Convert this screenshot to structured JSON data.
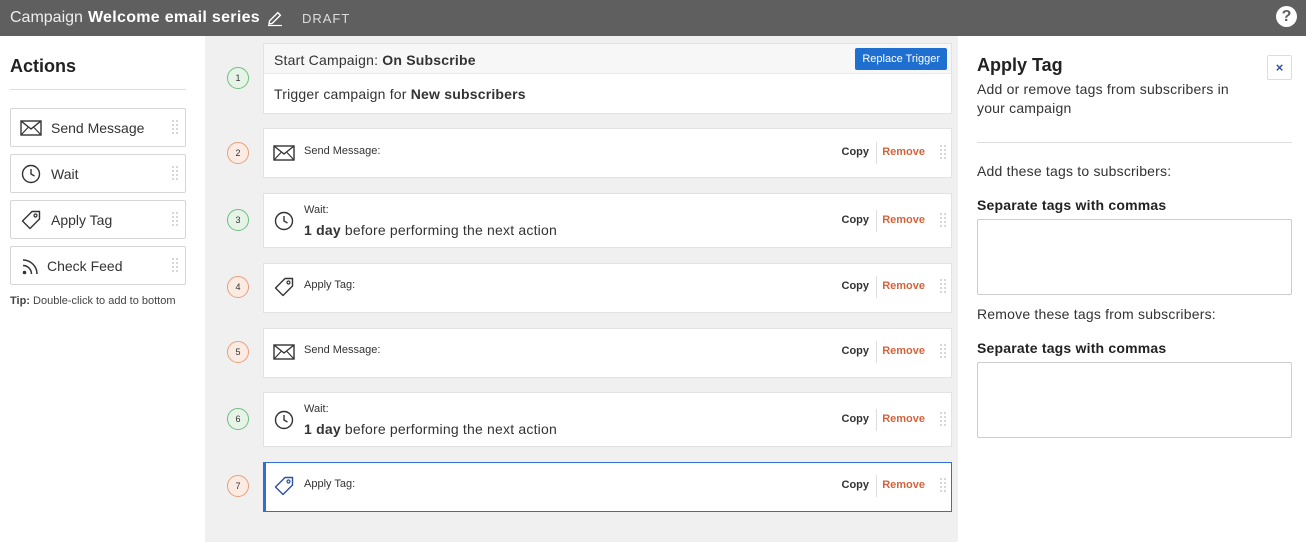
{
  "header": {
    "campaign_label": "Campaign",
    "campaign_name": "Welcome email series",
    "status": "DRAFT",
    "help": "?"
  },
  "actions_panel": {
    "title": "Actions",
    "items": [
      {
        "label": "Send Message",
        "icon": "envelope-icon"
      },
      {
        "label": "Wait",
        "icon": "clock-icon"
      },
      {
        "label": "Apply Tag",
        "icon": "tag-icon"
      },
      {
        "label": "Check Feed",
        "icon": "rss-feed-icon"
      }
    ],
    "tip_label": "Tip:",
    "tip_text": "Double-click to add to bottom"
  },
  "flow": {
    "trigger": {
      "number": "1",
      "label_prefix": "Start Campaign:",
      "label_value": "On Subscribe",
      "replace_button": "Replace Trigger",
      "desc_prefix": "Trigger campaign for",
      "desc_value": "New subscribers"
    },
    "steps": [
      {
        "number": "2",
        "title": "Send Message:",
        "icon": "envelope-icon"
      },
      {
        "number": "3",
        "title": "Wait:",
        "icon": "clock-icon",
        "desc_bold": "1 day",
        "desc_rest": "before performing the next action"
      },
      {
        "number": "4",
        "title": "Apply Tag:",
        "icon": "tag-icon"
      },
      {
        "number": "5",
        "title": "Send Message:",
        "icon": "envelope-icon"
      },
      {
        "number": "6",
        "title": "Wait:",
        "icon": "clock-icon",
        "desc_bold": "1 day",
        "desc_rest": "before performing the next action"
      },
      {
        "number": "7",
        "title": "Apply Tag:",
        "icon": "tag-icon",
        "selected": true
      }
    ],
    "copy_label": "Copy",
    "remove_label": "Remove"
  },
  "detail_panel": {
    "title": "Apply Tag",
    "subtitle": "Add or remove tags from subscribers in your campaign",
    "close": "×",
    "add_label": "Add these tags to subscribers:",
    "add_hint": "Separate tags with commas",
    "add_value": "",
    "remove_label": "Remove these tags from subscribers:",
    "remove_hint": "Separate tags with commas",
    "remove_value": ""
  },
  "colors": {
    "topbar": "#5f5f5f",
    "accent_blue": "#1f6fd1",
    "remove_orange": "#d2643c",
    "step_green": "#6cbf7c",
    "step_orange": "#e8a07a"
  }
}
